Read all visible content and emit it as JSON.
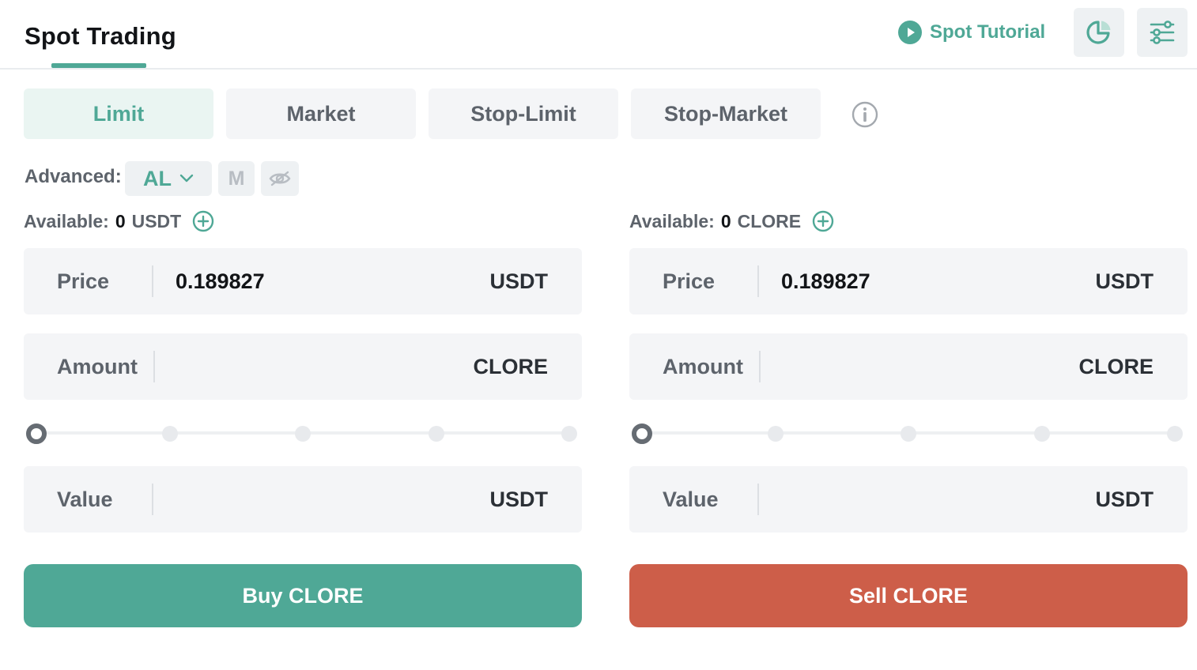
{
  "header": {
    "title": "Spot Trading",
    "tutorial_label": "Spot Tutorial",
    "accent_color": "#4fa896"
  },
  "order_types": {
    "tabs": [
      {
        "label": "Limit",
        "active": true
      },
      {
        "label": "Market",
        "active": false
      },
      {
        "label": "Stop-Limit",
        "active": false
      },
      {
        "label": "Stop-Market",
        "active": false
      }
    ]
  },
  "advanced": {
    "label": "Advanced:",
    "selected": "AL",
    "mode_m": "M"
  },
  "buy": {
    "available_label": "Available:",
    "available_amount": "0",
    "available_currency": "USDT",
    "price_label": "Price",
    "price_value": "0.189827",
    "price_unit": "USDT",
    "amount_label": "Amount",
    "amount_value": "",
    "amount_unit": "CLORE",
    "slider_percent": 0,
    "value_label": "Value",
    "value_value": "",
    "value_unit": "USDT",
    "button_label": "Buy CLORE",
    "button_color": "#4fa896"
  },
  "sell": {
    "available_label": "Available:",
    "available_amount": "0",
    "available_currency": "CLORE",
    "price_label": "Price",
    "price_value": "0.189827",
    "price_unit": "USDT",
    "amount_label": "Amount",
    "amount_value": "",
    "amount_unit": "CLORE",
    "slider_percent": 0,
    "value_label": "Value",
    "value_value": "",
    "value_unit": "USDT",
    "button_label": "Sell CLORE",
    "button_color": "#cd5e49"
  }
}
